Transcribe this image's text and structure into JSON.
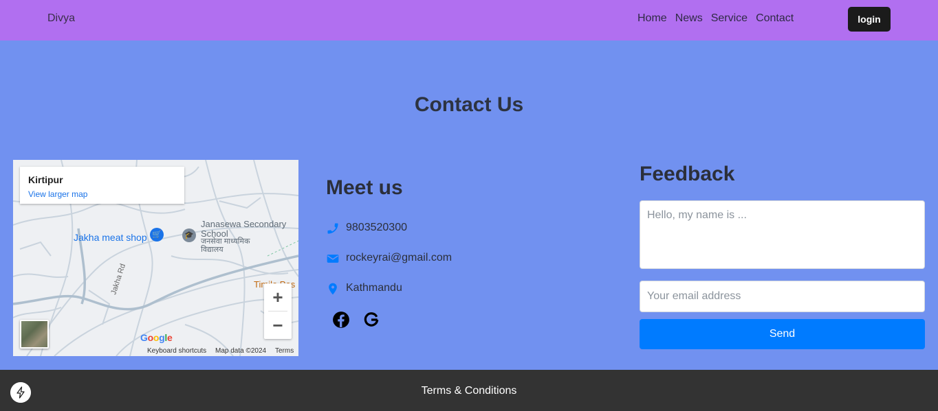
{
  "navbar": {
    "brand": "Divya",
    "links": [
      "Home",
      "News",
      "Service",
      "Contact"
    ],
    "login_label": "login"
  },
  "page_title": "Contact Us",
  "map": {
    "place_name": "Kirtipur",
    "larger_map_link": "View larger map",
    "poi_jakha": "Jakha meat shop",
    "poi_school": "Janasewa Secondary School",
    "poi_school_local": "जनसेवा माध्यमिक विद्यालय",
    "poi_timile": "Timile Pas",
    "road_label": "Jakha Rd",
    "zoom_in": "+",
    "zoom_out": "−",
    "logo": "Google",
    "footer_shortcuts": "Keyboard shortcuts",
    "footer_data": "Map data ©2024",
    "footer_terms": "Terms"
  },
  "meet": {
    "title": "Meet us",
    "phone": "9803520300",
    "email": "rockeyrai@gmail.com",
    "location": "Kathmandu",
    "icons": [
      "phone-icon",
      "envelope-icon",
      "map-pin-icon",
      "facebook-icon",
      "google-icon"
    ]
  },
  "feedback": {
    "title": "Feedback",
    "message_placeholder": "Hello, my name is ...",
    "email_placeholder": "Your email address",
    "send_label": "Send"
  },
  "footer": {
    "terms_label": "Terms & Conditions"
  },
  "colors": {
    "navbar": "#b16ff0",
    "page_bg": "#7191f0",
    "accent": "#007bff",
    "footer": "#333333"
  }
}
